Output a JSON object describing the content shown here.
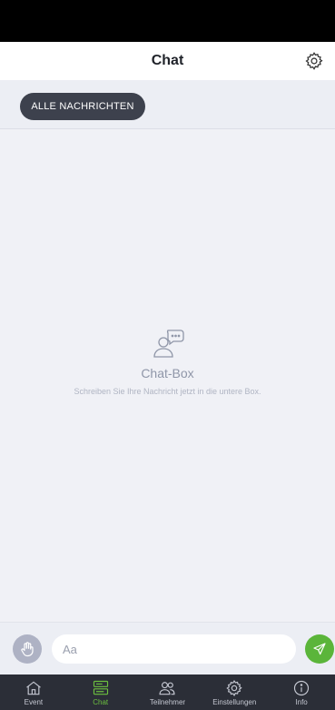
{
  "header": {
    "title": "Chat",
    "settings_icon": "gear-icon"
  },
  "filter": {
    "label": "ALLE NACHRICHTEN"
  },
  "empty_state": {
    "icon": "chat-person-icon",
    "title": "Chat-Box",
    "subtitle": "Schreiben Sie Ihre Nachricht jetzt in die untere Box."
  },
  "composer": {
    "placeholder": "Aa",
    "raise_hand_icon": "hand-icon",
    "send_icon": "send-icon"
  },
  "nav": {
    "items": [
      {
        "label": "Event",
        "icon": "home-icon",
        "active": false
      },
      {
        "label": "Chat",
        "icon": "chat-icon",
        "active": true
      },
      {
        "label": "Teilnehmer",
        "icon": "users-icon",
        "active": false
      },
      {
        "label": "Einstellungen",
        "icon": "gear-icon",
        "active": false
      },
      {
        "label": "Info",
        "icon": "info-icon",
        "active": false
      }
    ]
  },
  "colors": {
    "accent": "#6cbf3f",
    "send": "#5bb53a",
    "nav_bg": "#2b2e37",
    "chip_bg": "#3d414d"
  }
}
